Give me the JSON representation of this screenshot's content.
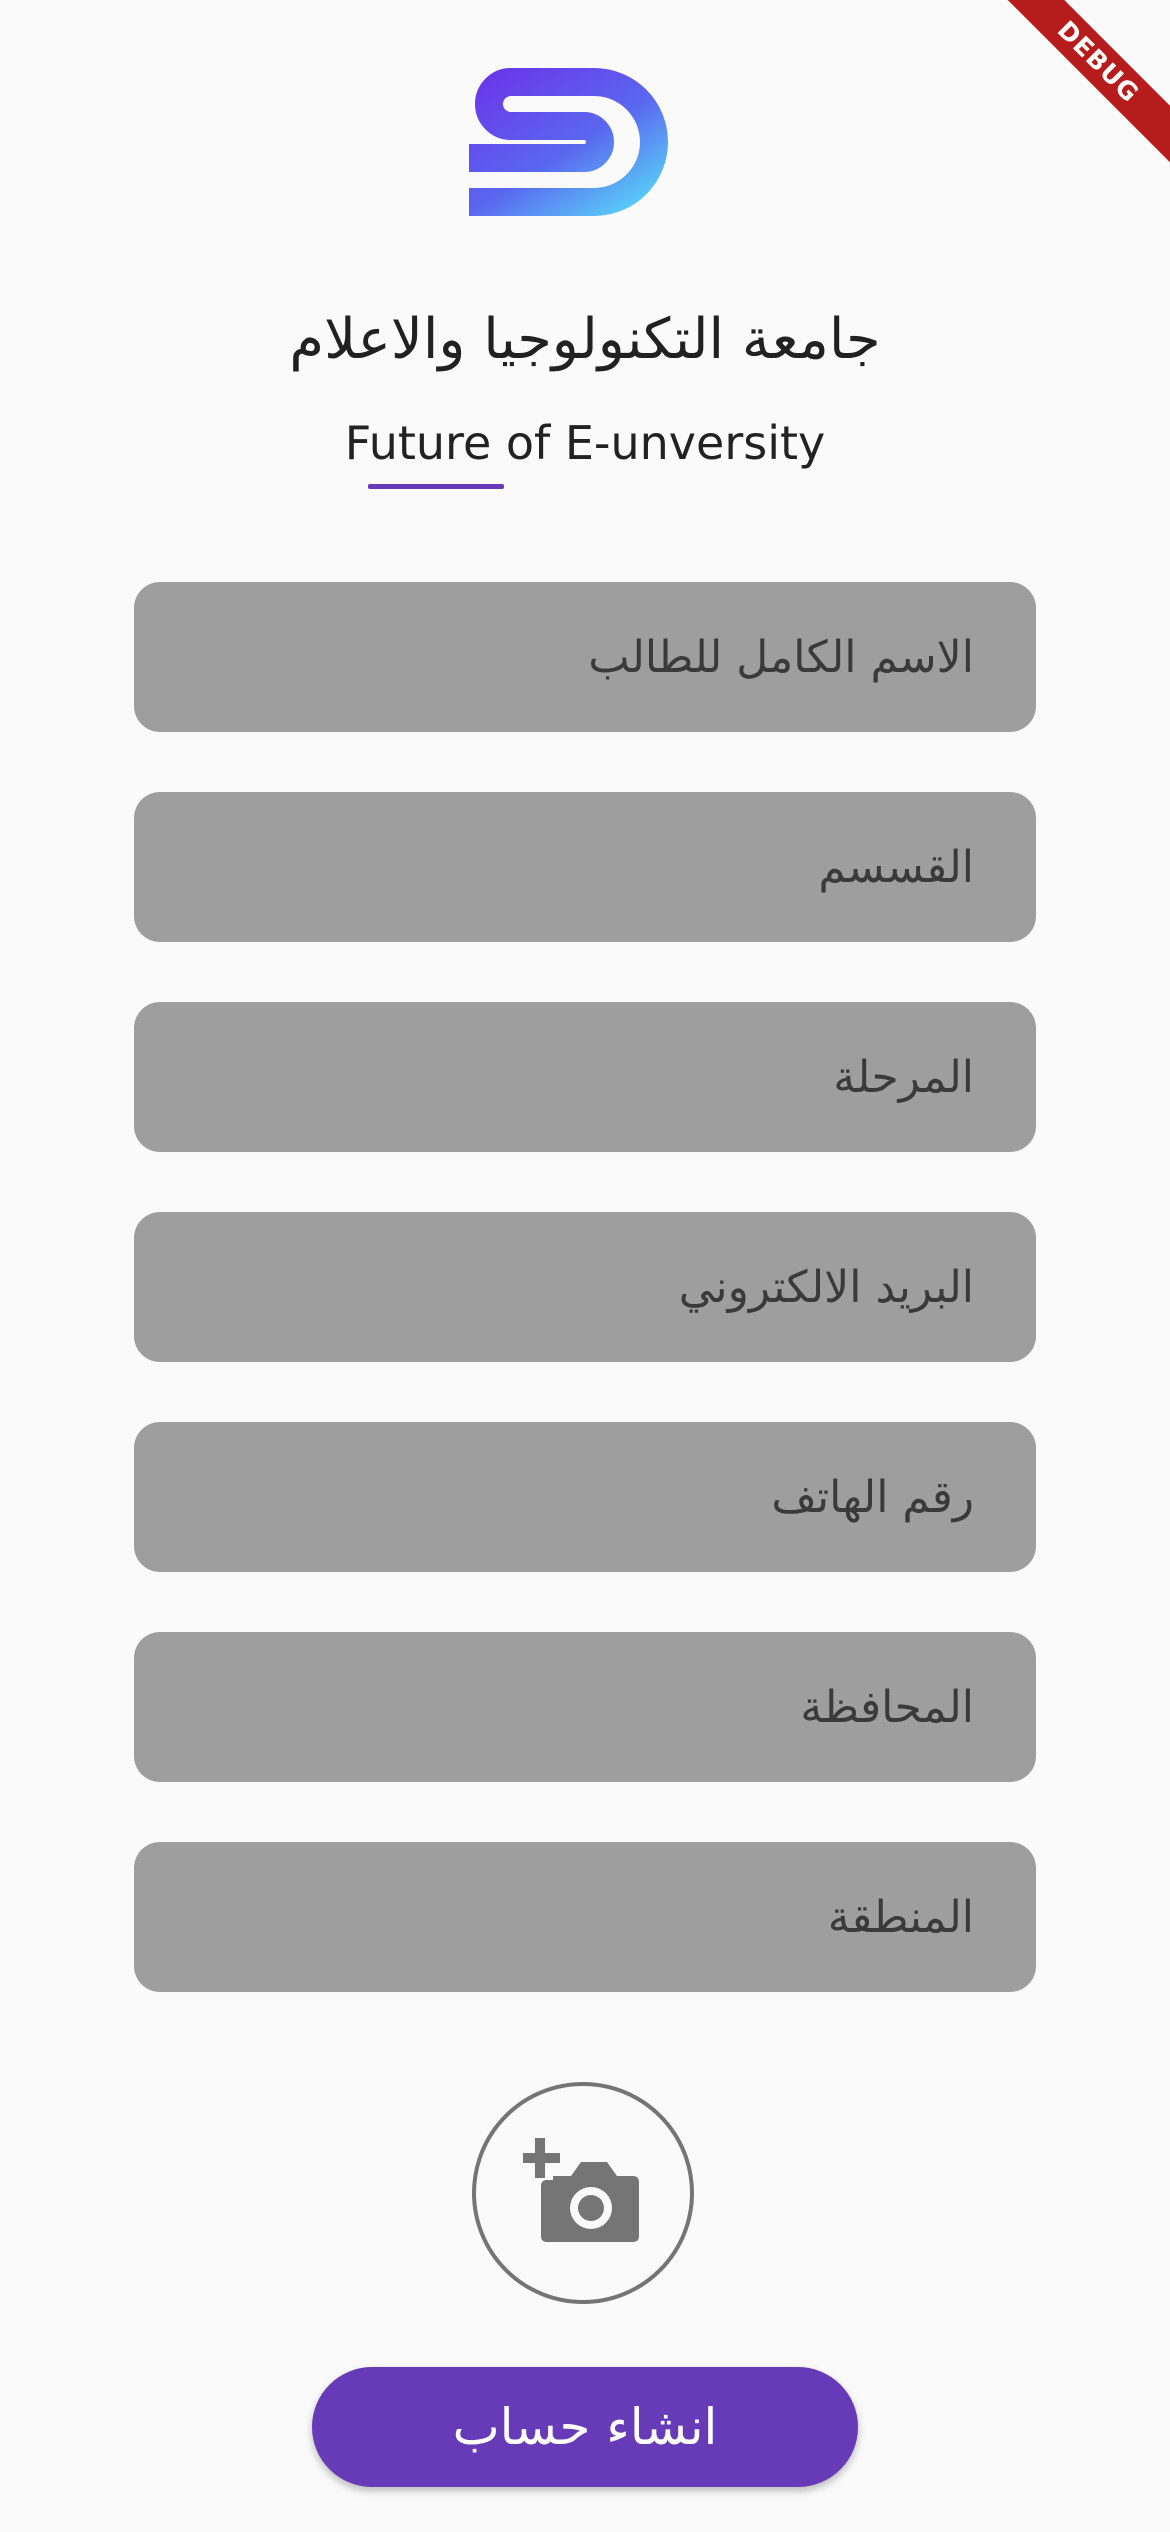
{
  "app": {
    "logo": "university-logo",
    "title": "جامعة التكنولوجيا والاعلام",
    "subtitle": "Future of E-unversity",
    "accent_color": "#673ab7",
    "debug_label": "DEBUG"
  },
  "form": {
    "fields": [
      {
        "placeholder": "الاسم الكامل للطالب"
      },
      {
        "placeholder": "القسسم"
      },
      {
        "placeholder": "المرحلة"
      },
      {
        "placeholder": "البريد الالكتروني"
      },
      {
        "placeholder": "رقم الهاتف"
      },
      {
        "placeholder": "المحافظة"
      },
      {
        "placeholder": "المنطقة"
      }
    ],
    "photo_icon": "add-a-photo-icon",
    "submit_label": "انشاء حساب"
  }
}
